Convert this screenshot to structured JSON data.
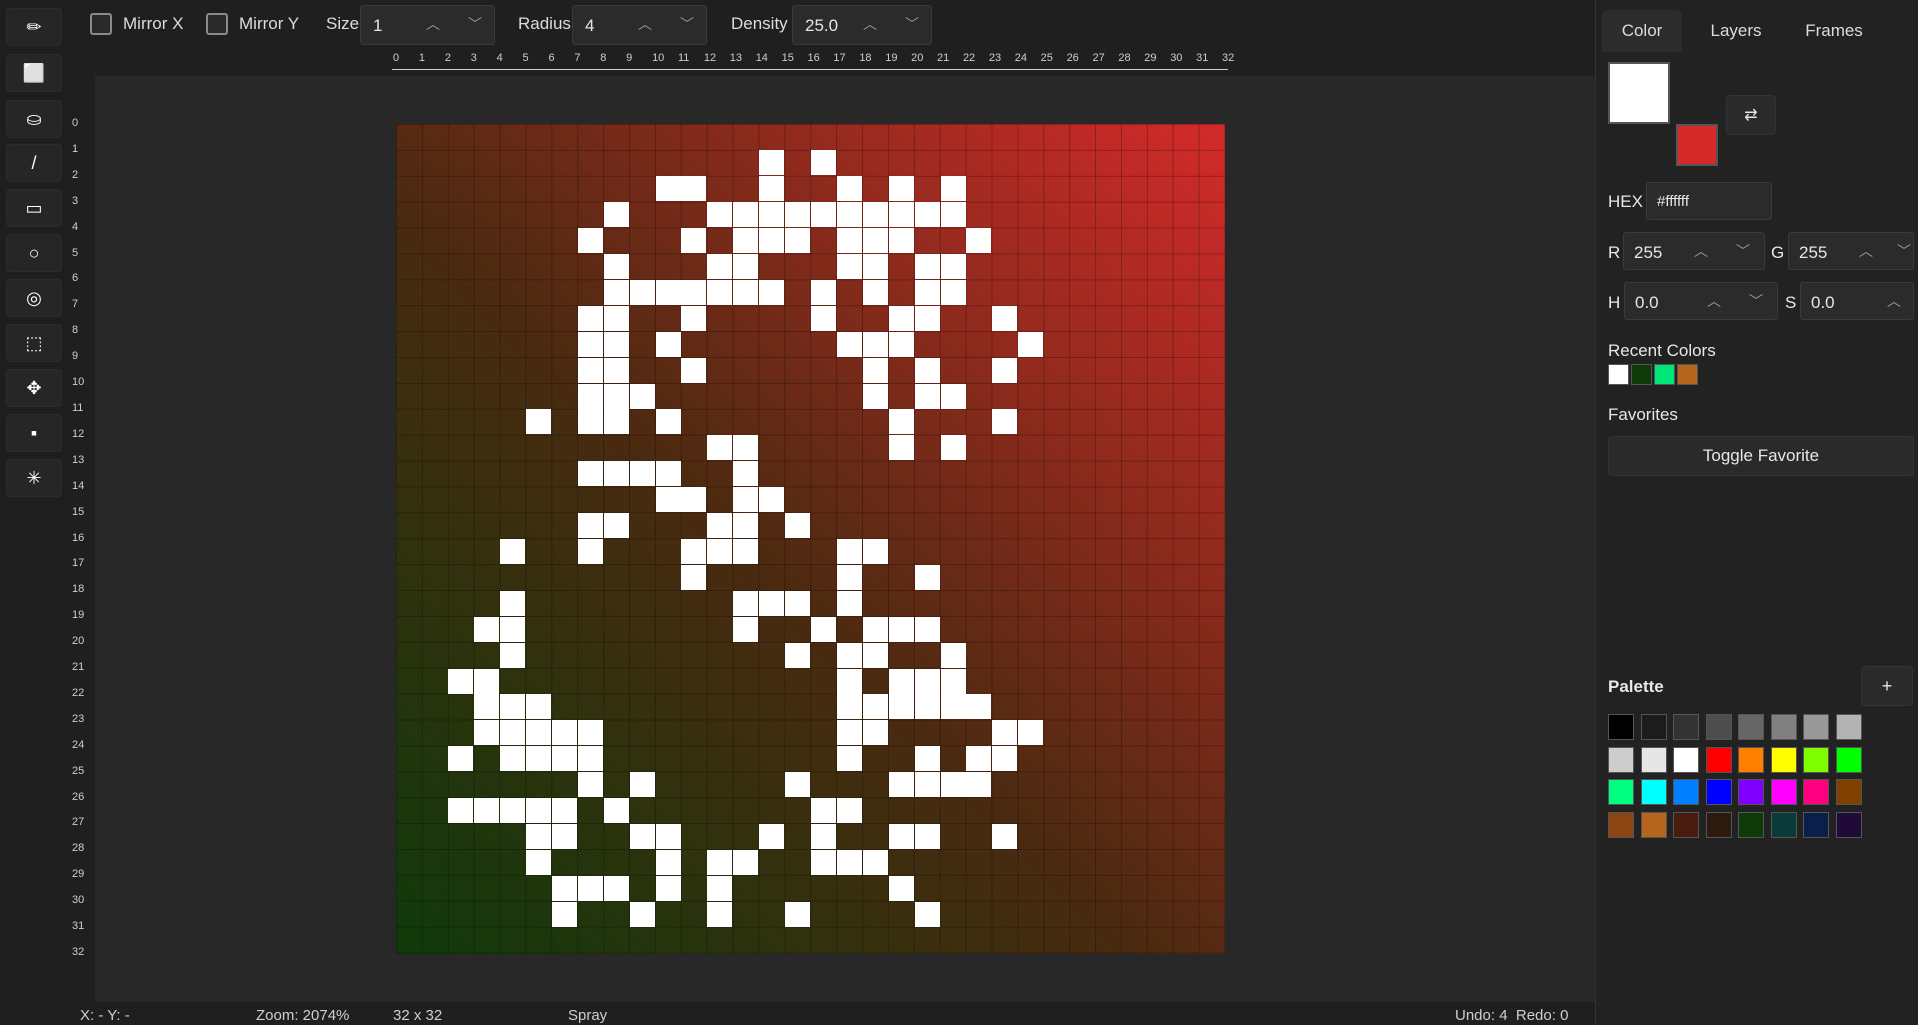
{
  "toolbar": {
    "tools": [
      {
        "name": "pencil-tool",
        "icon": "✏"
      },
      {
        "name": "eraser-tool",
        "icon": "⬜"
      },
      {
        "name": "fill-bucket-tool",
        "icon": "⛀"
      },
      {
        "name": "line-tool",
        "icon": "/"
      },
      {
        "name": "rectangle-tool",
        "icon": "▭"
      },
      {
        "name": "ellipse-tool",
        "icon": "○"
      },
      {
        "name": "spray-tool",
        "icon": "◎"
      },
      {
        "name": "select-tool",
        "icon": "⬚"
      },
      {
        "name": "move-tool",
        "icon": "✥"
      },
      {
        "name": "stamp-tool",
        "icon": "▪"
      },
      {
        "name": "magic-tool",
        "icon": "✳"
      }
    ]
  },
  "topbar": {
    "mirror_x": "Mirror X",
    "mirror_y": "Mirror Y",
    "size_label": "Size",
    "size_value": "1",
    "radius_label": "Radius",
    "radius_value": "4",
    "density_label": "Density",
    "density_value": "25.0"
  },
  "canvas": {
    "width": 32,
    "height": 32,
    "gradient_colors": [
      "#0f3a0a",
      "#4a2a10",
      "#d42a2a"
    ],
    "ruler_ticks": [
      "0",
      "1",
      "2",
      "3",
      "4",
      "5",
      "6",
      "7",
      "8",
      "9",
      "10",
      "11",
      "12",
      "13",
      "14",
      "15",
      "16",
      "17",
      "18",
      "19",
      "20",
      "21",
      "22",
      "23",
      "24",
      "25",
      "26",
      "27",
      "28",
      "29",
      "30",
      "31",
      "32"
    ],
    "white_pixels": [
      [
        14,
        1
      ],
      [
        16,
        1
      ],
      [
        10,
        2
      ],
      [
        11,
        2
      ],
      [
        14,
        2
      ],
      [
        17,
        2
      ],
      [
        19,
        2
      ],
      [
        21,
        2
      ],
      [
        8,
        3
      ],
      [
        12,
        3
      ],
      [
        13,
        3
      ],
      [
        14,
        3
      ],
      [
        15,
        3
      ],
      [
        16,
        3
      ],
      [
        17,
        3
      ],
      [
        18,
        3
      ],
      [
        19,
        3
      ],
      [
        20,
        3
      ],
      [
        21,
        3
      ],
      [
        7,
        4
      ],
      [
        11,
        4
      ],
      [
        13,
        4
      ],
      [
        14,
        4
      ],
      [
        15,
        4
      ],
      [
        17,
        4
      ],
      [
        18,
        4
      ],
      [
        19,
        4
      ],
      [
        22,
        4
      ],
      [
        8,
        5
      ],
      [
        12,
        5
      ],
      [
        13,
        5
      ],
      [
        17,
        5
      ],
      [
        18,
        5
      ],
      [
        20,
        5
      ],
      [
        21,
        5
      ],
      [
        8,
        6
      ],
      [
        9,
        6
      ],
      [
        10,
        6
      ],
      [
        11,
        6
      ],
      [
        12,
        6
      ],
      [
        13,
        6
      ],
      [
        14,
        6
      ],
      [
        16,
        6
      ],
      [
        18,
        6
      ],
      [
        20,
        6
      ],
      [
        21,
        6
      ],
      [
        7,
        7
      ],
      [
        8,
        7
      ],
      [
        11,
        7
      ],
      [
        16,
        7
      ],
      [
        19,
        7
      ],
      [
        20,
        7
      ],
      [
        23,
        7
      ],
      [
        7,
        8
      ],
      [
        8,
        8
      ],
      [
        10,
        8
      ],
      [
        17,
        8
      ],
      [
        18,
        8
      ],
      [
        19,
        8
      ],
      [
        24,
        8
      ],
      [
        7,
        9
      ],
      [
        8,
        9
      ],
      [
        11,
        9
      ],
      [
        18,
        9
      ],
      [
        20,
        9
      ],
      [
        23,
        9
      ],
      [
        7,
        10
      ],
      [
        8,
        10
      ],
      [
        9,
        10
      ],
      [
        18,
        10
      ],
      [
        20,
        10
      ],
      [
        21,
        10
      ],
      [
        5,
        11
      ],
      [
        7,
        11
      ],
      [
        8,
        11
      ],
      [
        10,
        11
      ],
      [
        19,
        11
      ],
      [
        23,
        11
      ],
      [
        12,
        12
      ],
      [
        13,
        12
      ],
      [
        19,
        12
      ],
      [
        21,
        12
      ],
      [
        7,
        13
      ],
      [
        8,
        13
      ],
      [
        9,
        13
      ],
      [
        10,
        13
      ],
      [
        13,
        13
      ],
      [
        10,
        14
      ],
      [
        11,
        14
      ],
      [
        13,
        14
      ],
      [
        14,
        14
      ],
      [
        7,
        15
      ],
      [
        8,
        15
      ],
      [
        12,
        15
      ],
      [
        13,
        15
      ],
      [
        15,
        15
      ],
      [
        4,
        16
      ],
      [
        7,
        16
      ],
      [
        11,
        16
      ],
      [
        12,
        16
      ],
      [
        13,
        16
      ],
      [
        17,
        16
      ],
      [
        18,
        16
      ],
      [
        11,
        17
      ],
      [
        17,
        17
      ],
      [
        20,
        17
      ],
      [
        4,
        18
      ],
      [
        13,
        18
      ],
      [
        14,
        18
      ],
      [
        15,
        18
      ],
      [
        17,
        18
      ],
      [
        3,
        19
      ],
      [
        4,
        19
      ],
      [
        13,
        19
      ],
      [
        16,
        19
      ],
      [
        18,
        19
      ],
      [
        19,
        19
      ],
      [
        20,
        19
      ],
      [
        4,
        20
      ],
      [
        15,
        20
      ],
      [
        17,
        20
      ],
      [
        18,
        20
      ],
      [
        21,
        20
      ],
      [
        2,
        21
      ],
      [
        3,
        21
      ],
      [
        17,
        21
      ],
      [
        19,
        21
      ],
      [
        20,
        21
      ],
      [
        21,
        21
      ],
      [
        3,
        22
      ],
      [
        4,
        22
      ],
      [
        5,
        22
      ],
      [
        17,
        22
      ],
      [
        18,
        22
      ],
      [
        19,
        22
      ],
      [
        20,
        22
      ],
      [
        21,
        22
      ],
      [
        22,
        22
      ],
      [
        3,
        23
      ],
      [
        4,
        23
      ],
      [
        5,
        23
      ],
      [
        6,
        23
      ],
      [
        7,
        23
      ],
      [
        17,
        23
      ],
      [
        18,
        23
      ],
      [
        23,
        23
      ],
      [
        24,
        23
      ],
      [
        2,
        24
      ],
      [
        4,
        24
      ],
      [
        5,
        24
      ],
      [
        6,
        24
      ],
      [
        7,
        24
      ],
      [
        17,
        24
      ],
      [
        20,
        24
      ],
      [
        22,
        24
      ],
      [
        23,
        24
      ],
      [
        7,
        25
      ],
      [
        9,
        25
      ],
      [
        15,
        25
      ],
      [
        19,
        25
      ],
      [
        20,
        25
      ],
      [
        21,
        25
      ],
      [
        22,
        25
      ],
      [
        2,
        26
      ],
      [
        3,
        26
      ],
      [
        4,
        26
      ],
      [
        5,
        26
      ],
      [
        6,
        26
      ],
      [
        8,
        26
      ],
      [
        16,
        26
      ],
      [
        17,
        26
      ],
      [
        5,
        27
      ],
      [
        6,
        27
      ],
      [
        9,
        27
      ],
      [
        10,
        27
      ],
      [
        14,
        27
      ],
      [
        16,
        27
      ],
      [
        19,
        27
      ],
      [
        20,
        27
      ],
      [
        23,
        27
      ],
      [
        5,
        28
      ],
      [
        10,
        28
      ],
      [
        12,
        28
      ],
      [
        13,
        28
      ],
      [
        16,
        28
      ],
      [
        17,
        28
      ],
      [
        18,
        28
      ],
      [
        6,
        29
      ],
      [
        7,
        29
      ],
      [
        8,
        29
      ],
      [
        10,
        29
      ],
      [
        12,
        29
      ],
      [
        19,
        29
      ],
      [
        6,
        30
      ],
      [
        9,
        30
      ],
      [
        12,
        30
      ],
      [
        15,
        30
      ],
      [
        20,
        30
      ]
    ]
  },
  "status": {
    "coords": "X: - Y: -",
    "zoom": "Zoom: 2074%",
    "dimensions": "32 x 32",
    "tool": "Spray",
    "undo_redo": "Undo: 4  Redo: 0"
  },
  "panel": {
    "tabs": [
      "Color",
      "Layers",
      "Frames"
    ],
    "primary_color": "#ffffff",
    "secondary_color": "#d42a2a",
    "swap_icon": "⇄",
    "hex_label": "HEX",
    "hex_value": "#ffffff",
    "r_label": "R",
    "r_value": "255",
    "g_label": "G",
    "g_value": "255",
    "h_label": "H",
    "h_value": "0.0",
    "s_label": "S",
    "s_value": "0.0",
    "recent_label": "Recent Colors",
    "recent_colors": [
      "#ffffff",
      "#0f3a0a",
      "#00e676",
      "#b5651d"
    ],
    "favorites_label": "Favorites",
    "toggle_favorite": "Toggle Favorite",
    "palette_label": "Palette",
    "palette_add": "+",
    "palette_colors": [
      "#000000",
      "#1c1c1c",
      "#333333",
      "#4d4d4d",
      "#666666",
      "#808080",
      "#999999",
      "#b3b3b3",
      "#cccccc",
      "#e6e6e6",
      "#ffffff",
      "#ff0000",
      "#ff8000",
      "#ffff00",
      "#80ff00",
      "#00ff00",
      "#00ff80",
      "#00ffff",
      "#0080ff",
      "#0000ff",
      "#8000ff",
      "#ff00ff",
      "#ff0080",
      "#804000",
      "#8b4513",
      "#b5651d",
      "#4a1c0f",
      "#2d1a0e",
      "#0f3a0a",
      "#0a3a3a",
      "#0a1f4a",
      "#1f0a3a"
    ]
  }
}
